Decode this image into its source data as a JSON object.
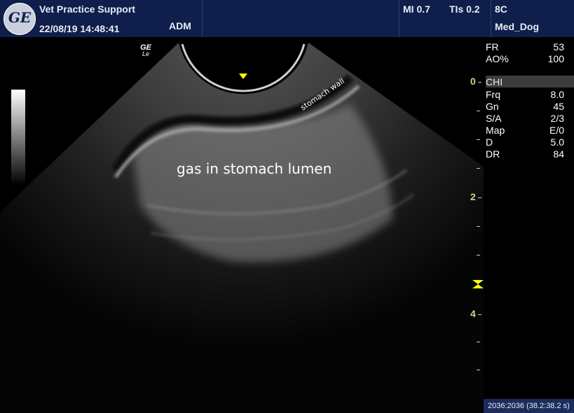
{
  "header": {
    "institution": "Vet Practice Support",
    "datetime": "22/08/19 14:48:41",
    "operator": "ADM",
    "mi": "MI 0.7",
    "tis": "TIs 0.2",
    "probe": "8C",
    "preset": "Med_Dog",
    "logo_text": "GE"
  },
  "image": {
    "probe_mark": "GE",
    "probe_mark_sub": "Le",
    "annotation_wall": "stomach wall",
    "annotation_lumen": "gas in stomach lumen"
  },
  "params_top": [
    {
      "key": "FR",
      "value": "53"
    },
    {
      "key": "AO%",
      "value": "100"
    }
  ],
  "mode_label": "CHI",
  "params": [
    {
      "key": "Frq",
      "value": "8.0"
    },
    {
      "key": "Gn",
      "value": "45"
    },
    {
      "key": "S/A",
      "value": "2/3"
    },
    {
      "key": "Map",
      "value": "E/0"
    },
    {
      "key": "D",
      "value": "5.0"
    },
    {
      "key": "DR",
      "value": "84"
    }
  ],
  "depth_scale": {
    "labels": [
      "0",
      "2",
      "4"
    ]
  },
  "status_bar": {
    "frames": "2036:2036",
    "time": "(38.2:38.2 s)"
  },
  "colors": {
    "header_bg": "#0f1e4a",
    "depth_color": "#d8d08a",
    "focus_marker": "#ffff00"
  }
}
